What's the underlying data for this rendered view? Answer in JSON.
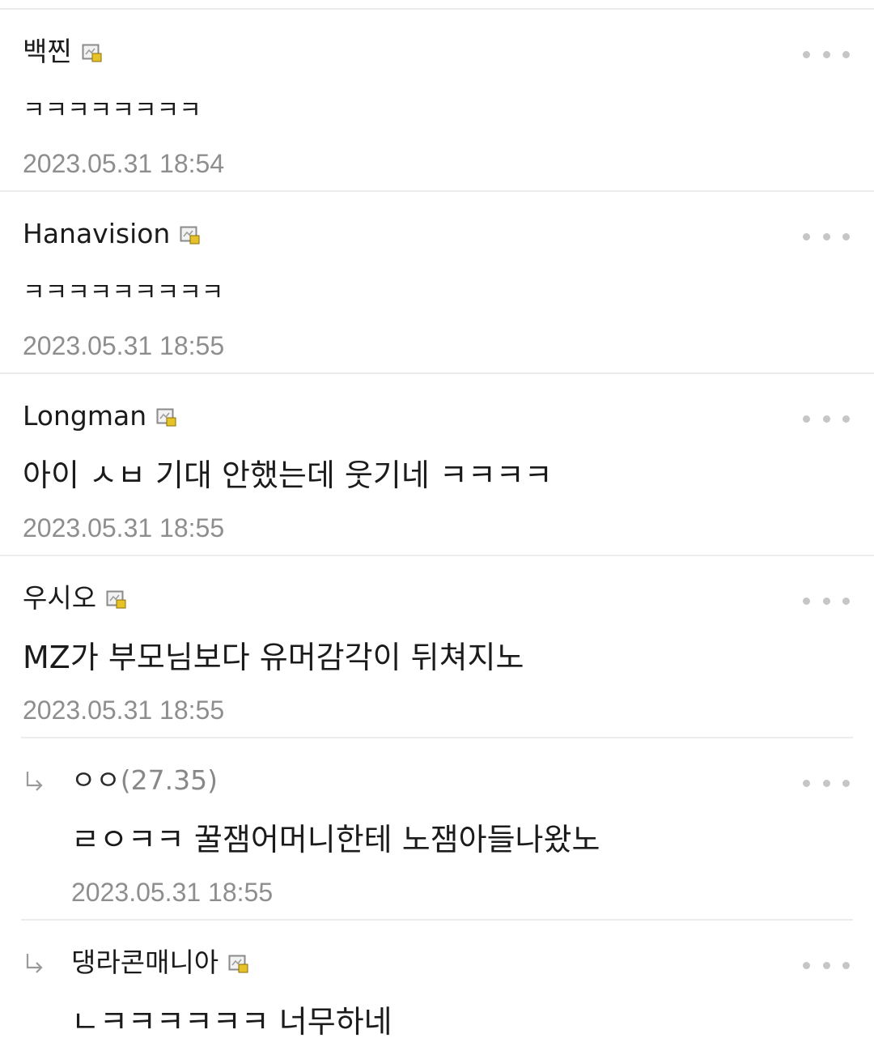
{
  "comments": [
    {
      "author": "백찐",
      "text": "ㅋㅋㅋㅋㅋㅋㅋㅋ",
      "timestamp": "2023.05.31 18:54",
      "member_icon": "member-badge-icon",
      "more_icon": "more-options-icon"
    },
    {
      "author": "Hanavision",
      "text": "ㅋㅋㅋㅋㅋㅋㅋㅋㅋ",
      "timestamp": "2023.05.31 18:55",
      "member_icon": "member-badge-icon",
      "more_icon": "more-options-icon"
    },
    {
      "author": "Longman",
      "text": "아이 ㅅㅂ 기대 안했는데 웃기네 ㅋㅋㅋㅋ",
      "timestamp": "2023.05.31 18:55",
      "member_icon": "member-badge-icon",
      "more_icon": "more-options-icon"
    },
    {
      "author": "우시오",
      "text": "MZ가 부모님보다 유머감각이 뒤쳐지노",
      "timestamp": "2023.05.31 18:55",
      "member_icon": "member-badge-icon",
      "more_icon": "more-options-icon"
    }
  ],
  "replies": [
    {
      "author": "ㅇㅇ",
      "ip": "(27.35)",
      "text": "ㄹㅇㅋㅋ 꿀잼어머니한테 노잼아들나왔노",
      "timestamp": "2023.05.31 18:55",
      "reply_icon": "reply-arrow-icon",
      "more_icon": "more-options-icon"
    },
    {
      "author": "댕라콘매니아",
      "text": "ㄴㅋㅋㅋㅋㅋㅋ 너무하네",
      "member_icon": "member-badge-icon",
      "reply_icon": "reply-arrow-icon",
      "more_icon": "more-options-icon"
    }
  ],
  "colors": {
    "divider": "#ececec",
    "timestamp": "#8e8e8e",
    "ip": "#888888",
    "dots": "#c6c6c6",
    "badge_border": "#8a8a8a",
    "badge_lock": "#e6c229"
  }
}
